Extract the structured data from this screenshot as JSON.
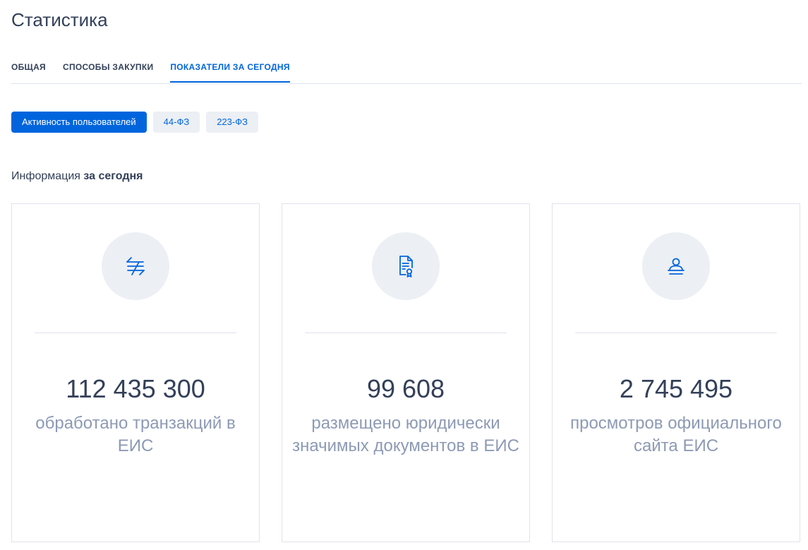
{
  "page": {
    "title": "Статистика"
  },
  "tabs": [
    {
      "label": "ОБЩАЯ",
      "active": false
    },
    {
      "label": "СПОСОБЫ ЗАКУПКИ",
      "active": false
    },
    {
      "label": "ПОКАЗАТЕЛИ ЗА СЕГОДНЯ",
      "active": true
    }
  ],
  "chips": [
    {
      "label": "Активность пользователей",
      "active": true
    },
    {
      "label": "44-ФЗ",
      "active": false
    },
    {
      "label": "223-ФЗ",
      "active": false
    }
  ],
  "section": {
    "prefix": "Информация",
    "emphasis": "за сегодня"
  },
  "cards": [
    {
      "icon": "transactions-arrows-icon",
      "value": "112 435 300",
      "label": "обработано транзакций в ЕИС"
    },
    {
      "icon": "signed-document-icon",
      "value": "99 608",
      "label": "размещено юридически значимых документов в ЕИС"
    },
    {
      "icon": "user-views-icon",
      "value": "2 745 495",
      "label": "просмотров официального сайта ЕИС"
    }
  ],
  "colors": {
    "accent": "#0065dd",
    "text": "#334059",
    "muted": "#8d9ab5",
    "chip_bg": "#eceff4",
    "border": "#dfe3eb"
  }
}
